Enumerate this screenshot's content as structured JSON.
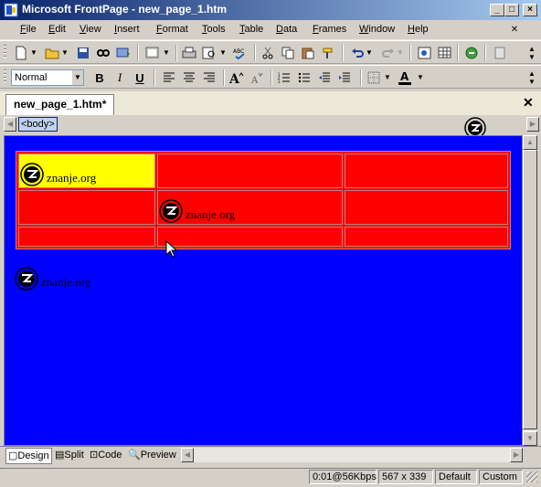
{
  "window": {
    "title": "Microsoft FrontPage - new_page_1.htm"
  },
  "menu": [
    "File",
    "Edit",
    "View",
    "Insert",
    "Format",
    "Tools",
    "Table",
    "Data",
    "Frames",
    "Window",
    "Help"
  ],
  "format_toolbar": {
    "style_value": "Normal",
    "bold": "B",
    "italic": "I",
    "underline": "U"
  },
  "document": {
    "tab_label": "new_page_1.htm*",
    "quick_tag": "<body>"
  },
  "canvas": {
    "logo_text": "znanje.org",
    "colors": {
      "background": "#0000ff",
      "table": "#ff0000",
      "highlight_cell": "#ffff00"
    }
  },
  "view_tabs": [
    "Design",
    "Split",
    "Code",
    "Preview"
  ],
  "status": {
    "download": "0:01@56Kbps",
    "size": "567 x 339",
    "mode": "Default",
    "css": "Custom"
  }
}
